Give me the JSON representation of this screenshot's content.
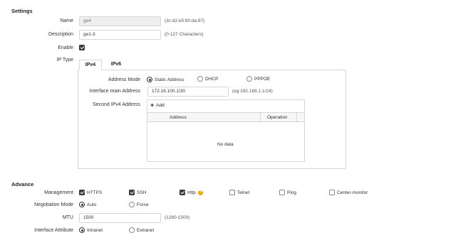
{
  "settings": {
    "title": "Settings",
    "name_label": "Name",
    "name_value": "ge4",
    "name_hint": "(3c:d2:e5:90:da:87)",
    "description_label": "Description",
    "description_value": "ge1-3",
    "description_hint": "(0-127 Characters)",
    "enable_label": "Enable",
    "enable_checked": true,
    "ip_type_label": "IP Type",
    "tabs": [
      {
        "label": "IPv4",
        "active": true
      },
      {
        "label": "IPv6",
        "active": false
      }
    ],
    "ipv4": {
      "address_mode_label": "Address Mode",
      "modes": [
        {
          "label": "Static Address",
          "selected": true
        },
        {
          "label": "DHCP",
          "selected": false
        },
        {
          "label": "PPPOE",
          "selected": false
        }
      ],
      "main_address_label": "Interface main Address",
      "main_address_value": "172.16.100.1/30",
      "main_address_hint": "(eg:192.168.1.1/24)",
      "second_address_label": "Second IPv4 Address",
      "add_label": "Add",
      "table_columns": [
        "Address",
        "Operation"
      ],
      "empty_text": "No data"
    }
  },
  "advance": {
    "title": "Advance",
    "management_label": "Management",
    "management": [
      {
        "label": "HTTPS",
        "checked": true
      },
      {
        "label": "SSH",
        "checked": true
      },
      {
        "label": "Http",
        "checked": true
      },
      {
        "label": "Telnet",
        "checked": false
      },
      {
        "label": "Ping",
        "checked": false
      },
      {
        "label": "Center-monitor",
        "checked": false
      }
    ],
    "negotiation_label": "Negotiation Mode",
    "negotiation": [
      {
        "label": "Auto",
        "selected": true
      },
      {
        "label": "Force",
        "selected": false
      }
    ],
    "mtu_label": "MTU",
    "mtu_value": "1500",
    "mtu_hint": "(1280-1500)",
    "attribute_label": "Interface Attribute",
    "attribute": [
      {
        "label": "Intranet",
        "selected": true
      },
      {
        "label": "Extranet",
        "selected": false
      }
    ]
  },
  "colors": {
    "border": "#d6d6d6",
    "disabled_bg": "#eeeeee",
    "help_icon": "#f0a800"
  }
}
